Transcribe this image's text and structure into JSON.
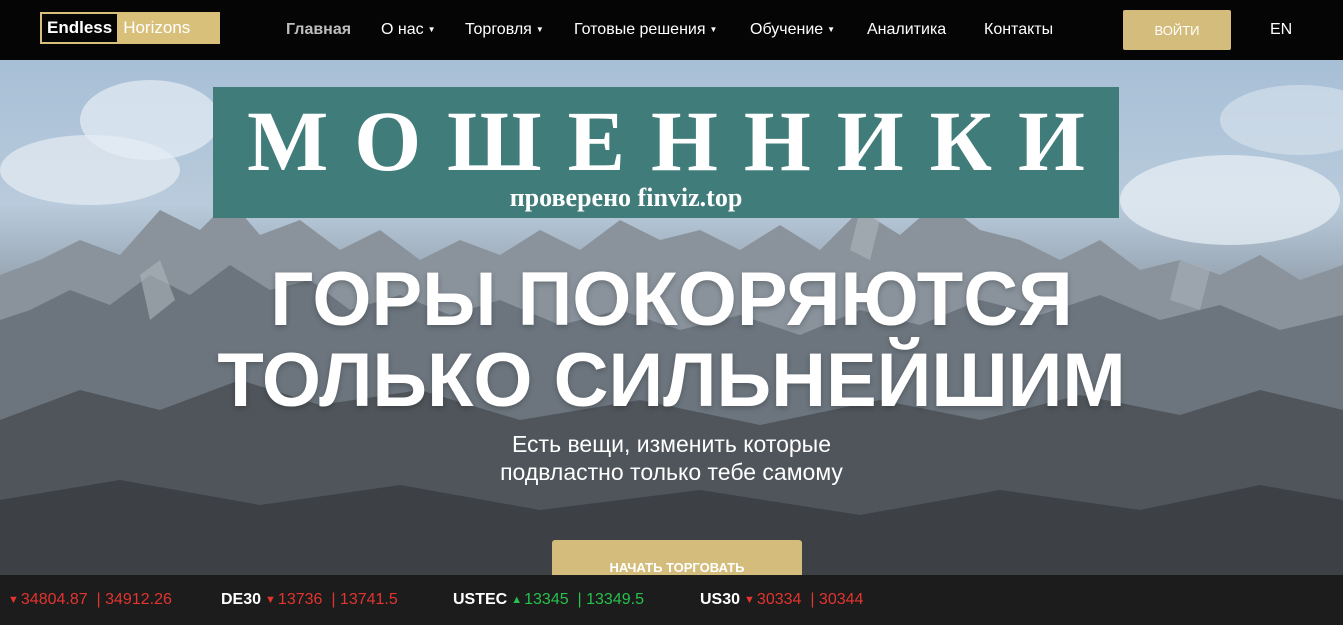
{
  "brand": {
    "part1": "Endless",
    "part2": "Horizons"
  },
  "nav": {
    "items": [
      {
        "label": "Главная",
        "active": true,
        "dropdown": false
      },
      {
        "label": "О нас",
        "dropdown": true
      },
      {
        "label": "Торговля",
        "dropdown": true
      },
      {
        "label": "Готовые решения",
        "dropdown": true
      },
      {
        "label": "Обучение",
        "dropdown": true
      },
      {
        "label": "Аналитика",
        "dropdown": false
      },
      {
        "label": "Контакты",
        "dropdown": false
      }
    ],
    "login_label": "ВОЙТИ",
    "lang_label": "EN"
  },
  "stamp": {
    "title": "МОШЕННИКИ",
    "subtitle": "проверено finviz.top"
  },
  "hero": {
    "headline_line1": "ГОРЫ ПОКОРЯЮТСЯ",
    "headline_line2": "ТОЛЬКО СИЛЬНЕЙШИМ",
    "sub_line1": "Есть вещи, изменить которые",
    "sub_line2": "подвластно только тебе самому",
    "cta_label": "НАЧАТЬ ТОРГОВАТЬ"
  },
  "ticker": [
    {
      "symbol": "",
      "direction": "down",
      "bid": "34804.87",
      "ask": "34912.26"
    },
    {
      "symbol": "DE30",
      "direction": "down",
      "bid": "13736",
      "ask": "13741.5"
    },
    {
      "symbol": "USTEC",
      "direction": "up",
      "bid": "13345",
      "ask": "13349.5"
    },
    {
      "symbol": "US30",
      "direction": "down",
      "bid": "30334",
      "ask": "30344"
    }
  ],
  "colors": {
    "accent_gold": "#d4bd7c",
    "stamp_teal": "#3f7c7a",
    "price_down": "#e3342f",
    "price_up": "#27c24c"
  }
}
